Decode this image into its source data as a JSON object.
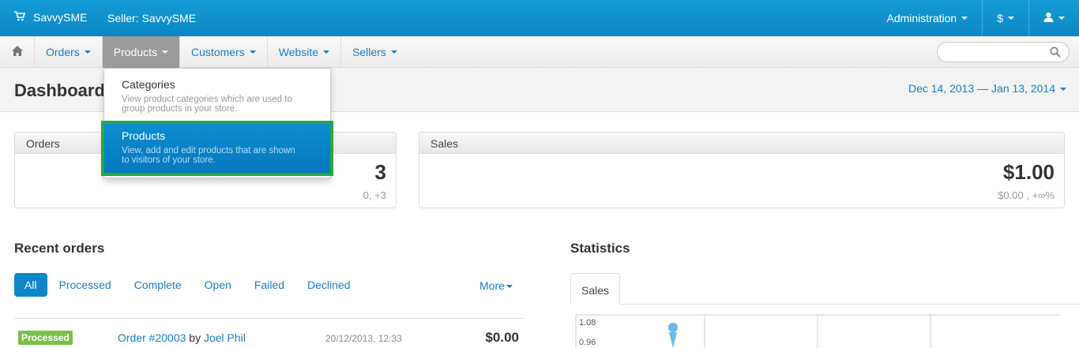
{
  "topbar": {
    "brand": "SavvySME",
    "seller": "Seller: SavvySME",
    "admin_label": "Administration",
    "currency_label": "$"
  },
  "nav": {
    "items": [
      "Orders",
      "Products",
      "Customers",
      "Website",
      "Sellers"
    ],
    "active": "Products",
    "search_placeholder": ""
  },
  "header": {
    "title": "Dashboard",
    "date_range": "Dec 14, 2013 — Jan 13, 2014"
  },
  "dropdown": {
    "items": [
      {
        "title": "Categories",
        "desc_lines": [
          "View product categories which are used to",
          "group products in your store."
        ]
      },
      {
        "title": "Products",
        "desc_lines": [
          "View, add and edit products that are shown",
          "to visitors of your store."
        ]
      }
    ]
  },
  "orders_box": {
    "label": "Orders",
    "value": "3",
    "sub": "0, +3"
  },
  "sales_box": {
    "label": "Sales",
    "value": "$1.00",
    "sub": "$0.00 , +∞%"
  },
  "recent_orders": {
    "title": "Recent orders",
    "tabs": [
      "All",
      "Processed",
      "Complete",
      "Open",
      "Failed",
      "Declined"
    ],
    "more_label": "More",
    "row": {
      "status": "Processed",
      "order": "Order #20003",
      "by": "by",
      "customer": "Joel Phil",
      "date": "20/12/2013, 12:33",
      "total": "$0.00"
    }
  },
  "statistics": {
    "title": "Statistics",
    "tab": "Sales",
    "y_ticks": [
      "1.08",
      "0.96"
    ]
  },
  "colors": {
    "topbar": "#0e8fcd",
    "link": "#1d7cbf",
    "highlight": "#0677bb",
    "highlight_border": "#27a745",
    "badge": "#7cc04a"
  }
}
